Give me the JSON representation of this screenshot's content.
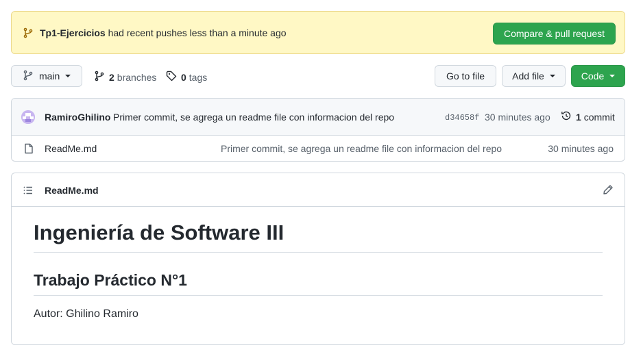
{
  "banner": {
    "repo_name": "Tp1-Ejercicios",
    "message": " had recent pushes less than a minute ago",
    "compare_label": "Compare & pull request"
  },
  "toolbar": {
    "branch": "main",
    "branches_count": "2",
    "branches_label": "branches",
    "tags_count": "0",
    "tags_label": "tags",
    "go_to_file": "Go to file",
    "add_file": "Add file",
    "code": "Code"
  },
  "latest_commit": {
    "author": "RamiroGhilino",
    "message": "Primer commit, se agrega un readme file con informacion del repo",
    "sha": "d34658f",
    "time": "30 minutes ago",
    "count": "1",
    "count_label": "commit"
  },
  "files": [
    {
      "name": "ReadMe.md",
      "message": "Primer commit, se agrega un readme file con informacion del repo",
      "time": "30 minutes ago"
    }
  ],
  "readme": {
    "filename": "ReadMe.md",
    "h1": "Ingeniería de Software III",
    "h2": "Trabajo Práctico N°1",
    "paragraph": "Autor: Ghilino Ramiro"
  },
  "colors": {
    "banner_bg": "#fff8c5",
    "primary_green": "#2da44e",
    "border": "#d0d7de"
  },
  "icons": [
    "git-branch-icon",
    "tag-icon",
    "history-icon",
    "file-icon",
    "list-icon",
    "pencil-icon",
    "caret-down-icon"
  ]
}
